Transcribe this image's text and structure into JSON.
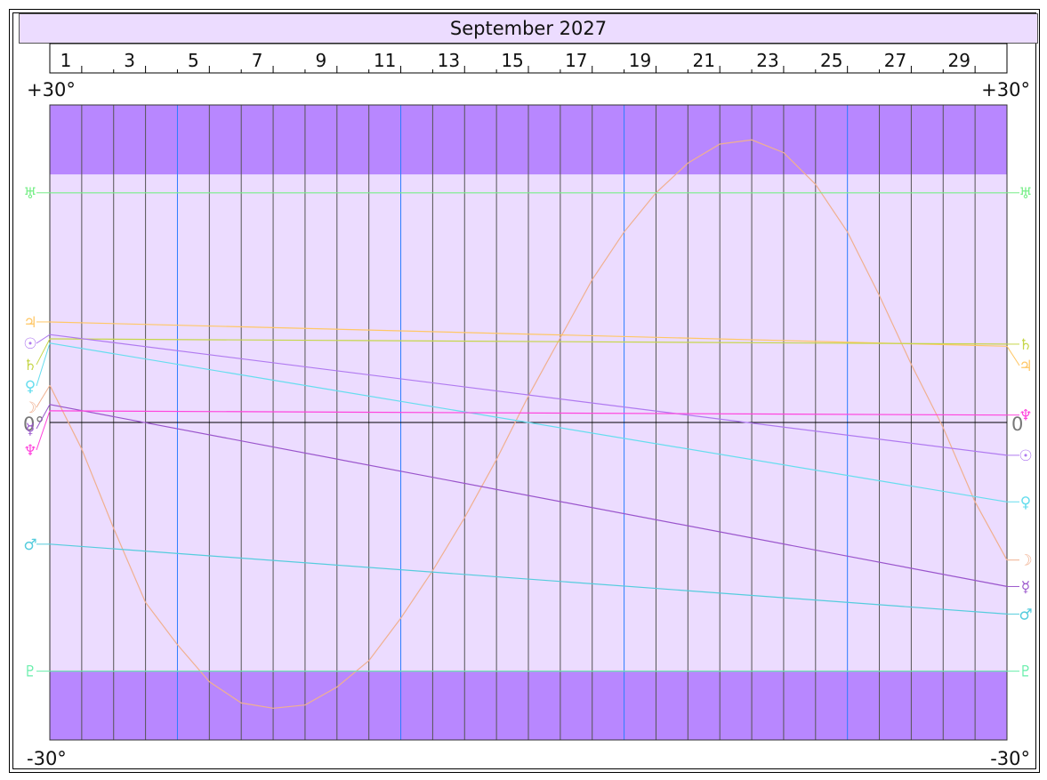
{
  "title": "September 2027",
  "colors": {
    "band": "#b887ff",
    "field": "#ecdcff",
    "grid": "#555555",
    "week_line": "#2b7dff",
    "zero_line": "#000000"
  },
  "chart_data": {
    "type": "line",
    "title": "September 2027",
    "x_unit": "day of month",
    "xlim": [
      1,
      31
    ],
    "ylim": [
      -30,
      30
    ],
    "y_top_label": "+30°",
    "y_bottom_label": "-30°",
    "zero_label_left": "0°",
    "zero_label_right": "0",
    "shaded_band_limits": [
      23.44,
      -23.44
    ],
    "week_lines": [
      5,
      12,
      19,
      26
    ],
    "day_labels": [
      "1",
      "3",
      "5",
      "7",
      "9",
      "11",
      "13",
      "15",
      "17",
      "19",
      "21",
      "23",
      "25",
      "27",
      "29"
    ],
    "series": [
      {
        "glyph": "☽",
        "color": "#f0b090",
        "x": [
          1,
          2,
          3,
          4,
          5,
          6,
          7,
          8,
          9,
          10,
          11,
          12,
          13,
          14,
          15,
          16,
          17,
          18,
          19,
          20,
          21,
          22,
          23,
          24,
          25,
          26,
          27,
          28,
          29,
          30,
          31
        ],
        "y": [
          3.5,
          -2.5,
          -10,
          -17,
          -21,
          -24.5,
          -26.5,
          -27,
          -26.7,
          -25,
          -22.5,
          -18.5,
          -14,
          -9,
          -3.5,
          2.5,
          8,
          13.5,
          18,
          21.7,
          24.5,
          26.3,
          26.7,
          25.5,
          22.5,
          18,
          12,
          5.5,
          -0.5,
          -7.5,
          -13
        ]
      },
      {
        "glyph": "♃",
        "color": "#ffc766",
        "x": [
          1,
          31
        ],
        "y": [
          9.5,
          7.2
        ]
      },
      {
        "glyph": "♄",
        "color": "#c6d64a",
        "x": [
          1,
          31
        ],
        "y": [
          7.9,
          7.4
        ]
      },
      {
        "glyph": "☉",
        "color": "#b07af0",
        "x": [
          1,
          31
        ],
        "y": [
          8.3,
          -3.1
        ]
      },
      {
        "glyph": "♀",
        "color": "#66ddee",
        "x": [
          1,
          31
        ],
        "y": [
          7.5,
          -7.5
        ]
      },
      {
        "glyph": "☿",
        "color": "#9a55cc",
        "x": [
          1,
          31
        ],
        "y": [
          1.7,
          -15.5
        ]
      },
      {
        "glyph": "♆",
        "color": "#ff44dd",
        "x": [
          1,
          31
        ],
        "y": [
          1.1,
          0.7
        ]
      },
      {
        "glyph": "♂",
        "color": "#55ccdd",
        "x": [
          1,
          31
        ],
        "y": [
          -11.5,
          -18.1
        ]
      },
      {
        "glyph": "♅",
        "color": "#77ee88",
        "x": [
          1,
          31
        ],
        "y": [
          21.7,
          21.7
        ]
      },
      {
        "glyph": "♇",
        "color": "#66eeaa",
        "x": [
          1,
          31
        ],
        "y": [
          -23.5,
          -23.5
        ]
      }
    ]
  }
}
